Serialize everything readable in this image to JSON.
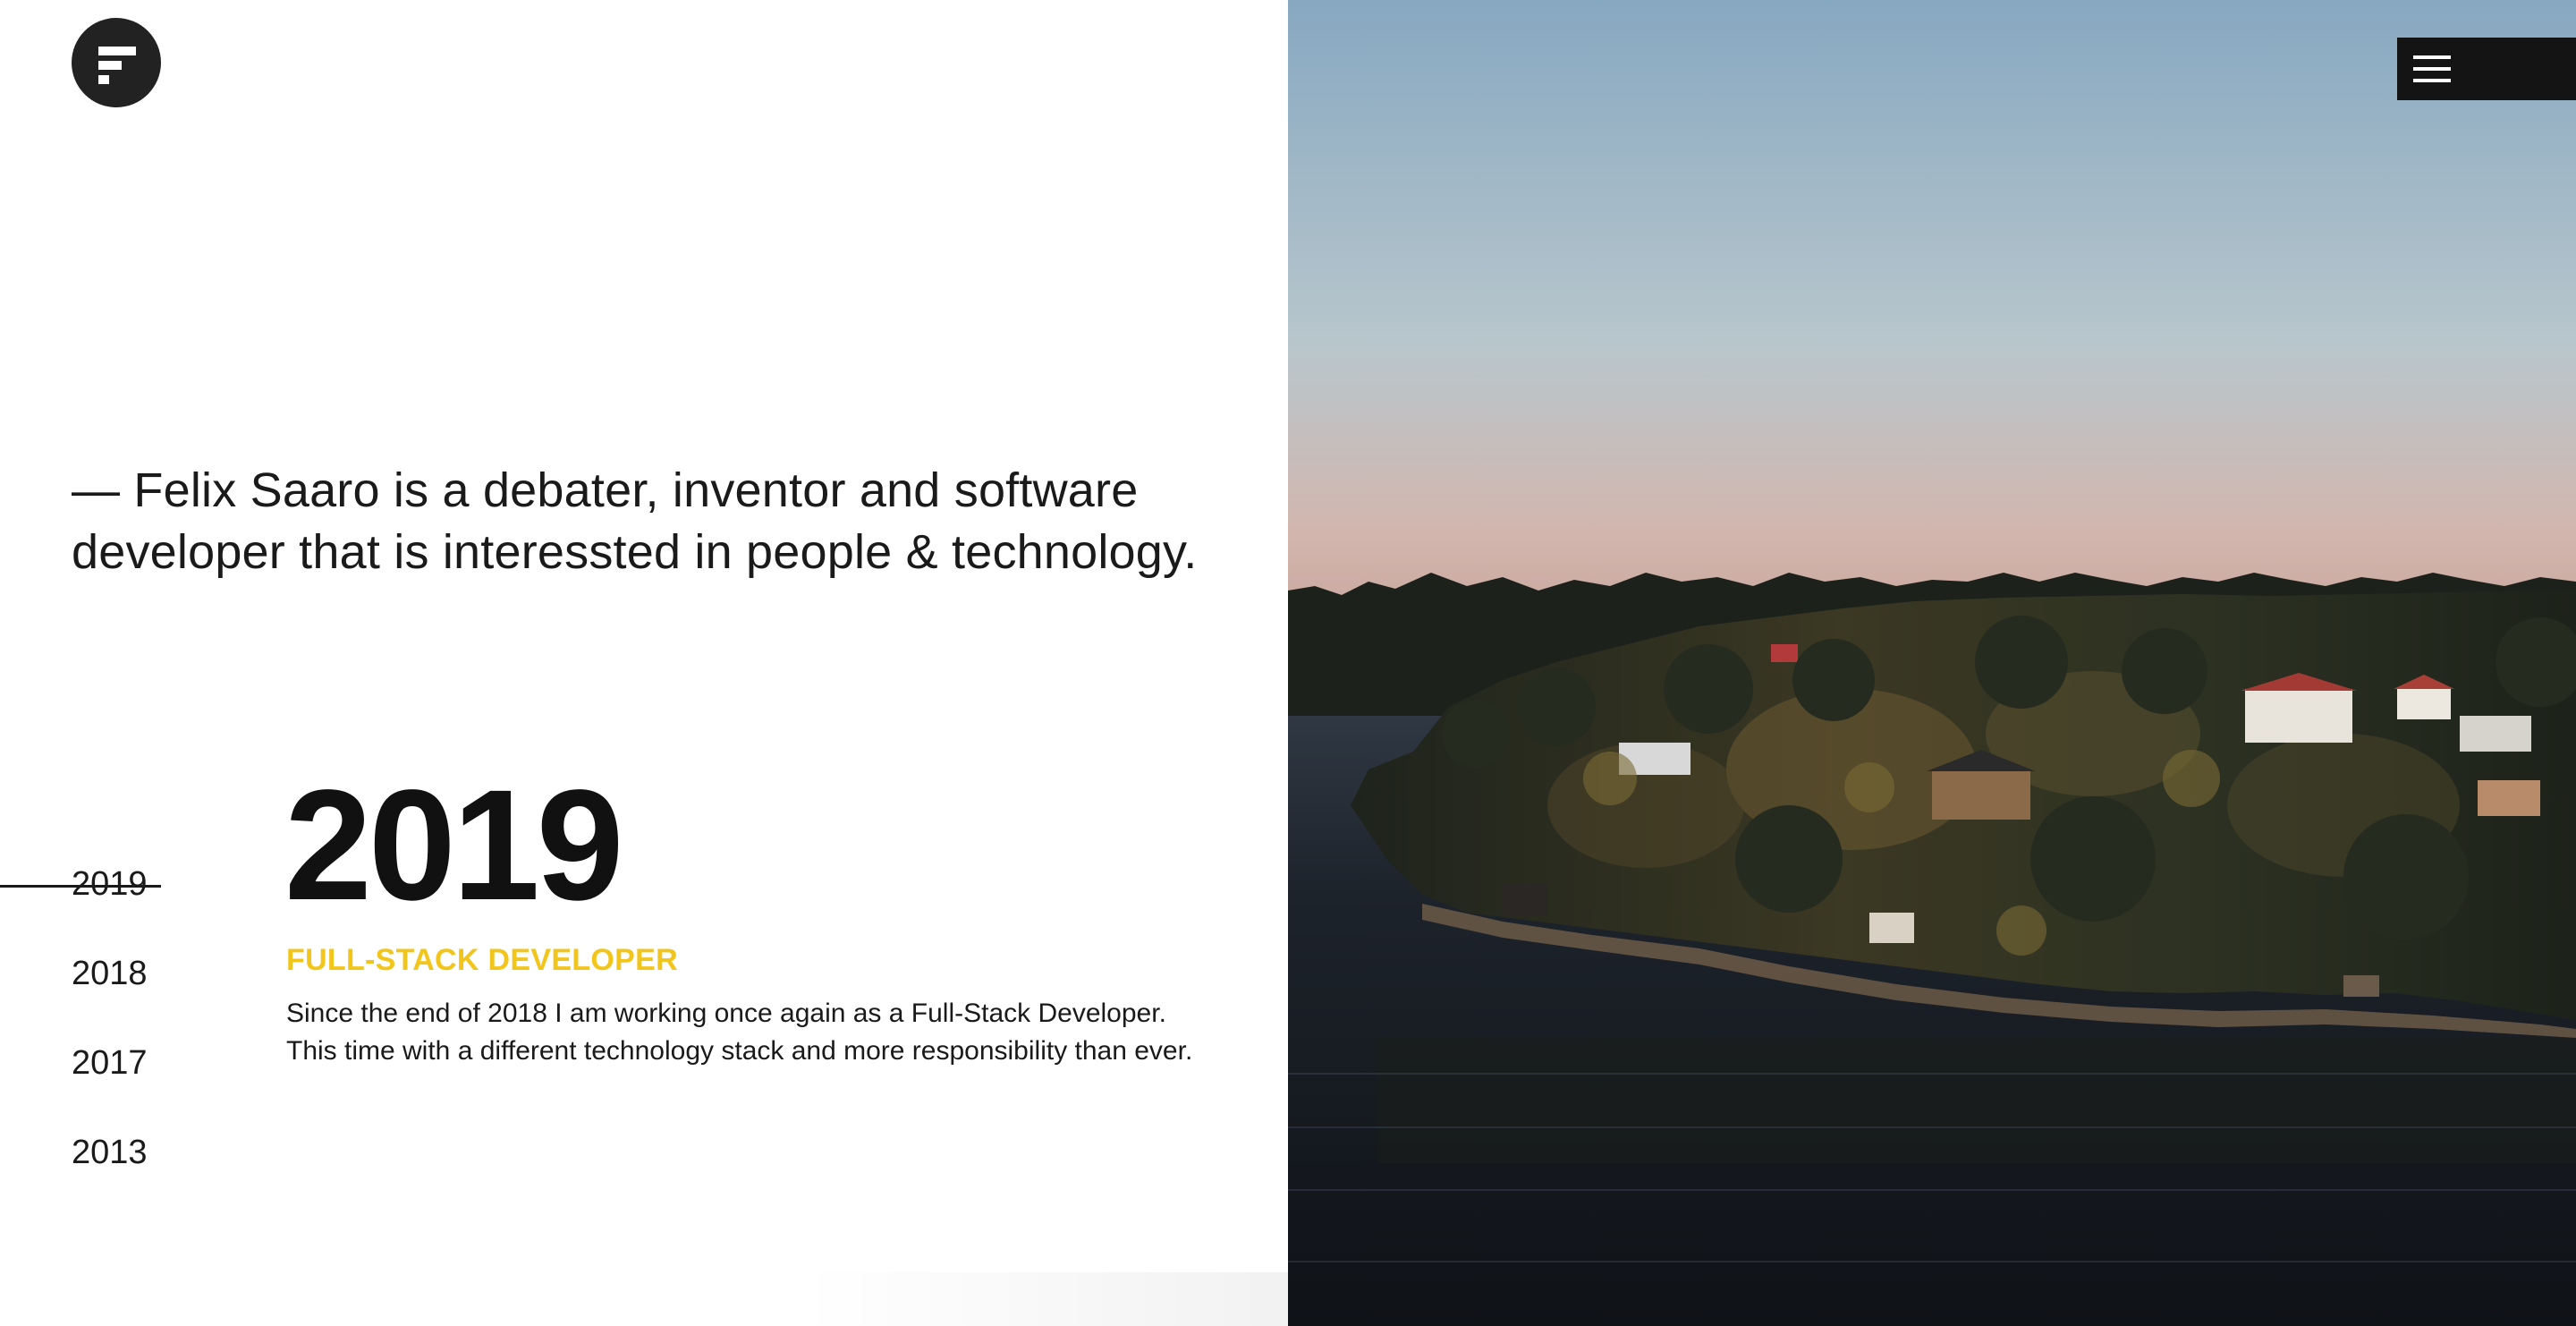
{
  "intro": {
    "text": "— Felix Saaro is a debater, inventor and software developer that is interessted in people & technology."
  },
  "timeline": {
    "years": [
      "2019",
      "2018",
      "2017",
      "2013"
    ],
    "active_index": 0,
    "active_year": "2019",
    "role": "FULL-STACK DEVELOPER",
    "description": "Since the end of 2018 I am working once again as a Full-Stack Developer. This time with a different technology stack and more responsibility than ever."
  },
  "icons": {
    "logo": "f-logo-icon",
    "menu": "hamburger-menu-icon"
  },
  "colors": {
    "accent": "#f2c51d",
    "text": "#1a1a1a",
    "menu_bg": "#141414"
  }
}
